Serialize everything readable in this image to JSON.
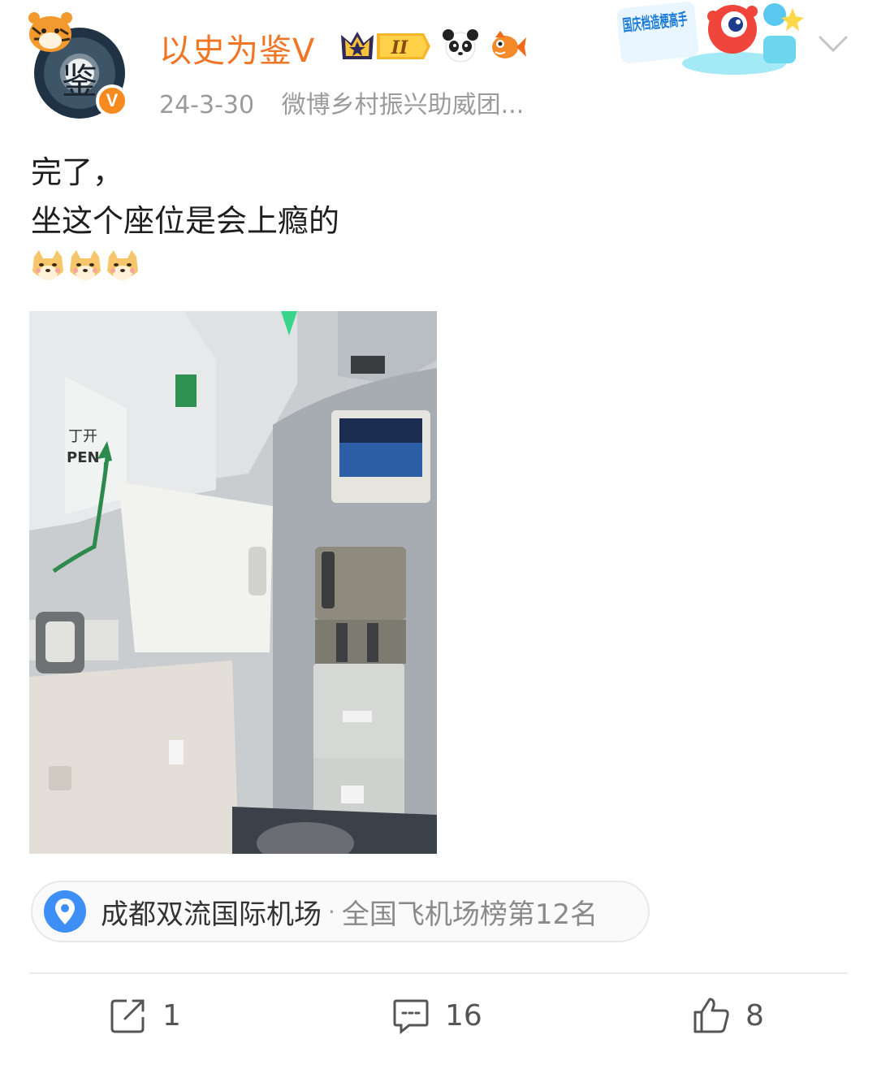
{
  "post": {
    "username": "以史为鉴V",
    "timestamp": "24-3-30",
    "source": "微博乡村振兴助威团...",
    "avatar_glyph": "鉴",
    "verified_mark": "V",
    "level_badge": "II",
    "promo_badge": "国庆档造梗高手",
    "text_line1": "完了，",
    "text_line2": "坐这个座位是会上瘾的",
    "emoji_count": 3
  },
  "location": {
    "name": "成都双流国际机场",
    "separator": "·",
    "rank": "全国飞机场榜第12名"
  },
  "actions": {
    "repost_count": "1",
    "comment_count": "16",
    "like_count": "8"
  },
  "icons": {
    "avatar": "avatar",
    "verified": "verified-v-icon",
    "crown": "crown-badge-icon",
    "panda": "panda-icon",
    "fish": "fish-icon",
    "more": "chevron-down-icon",
    "location": "location-pin-icon",
    "repost": "repost-icon",
    "comment": "comment-icon",
    "like": "thumbs-up-icon",
    "emoji": "doge-emoji-icon"
  },
  "colors": {
    "username": "#f07524",
    "verified_badge": "#f58a1f",
    "pin": "#3d8ef6",
    "meta_text": "#9b9b9b"
  }
}
